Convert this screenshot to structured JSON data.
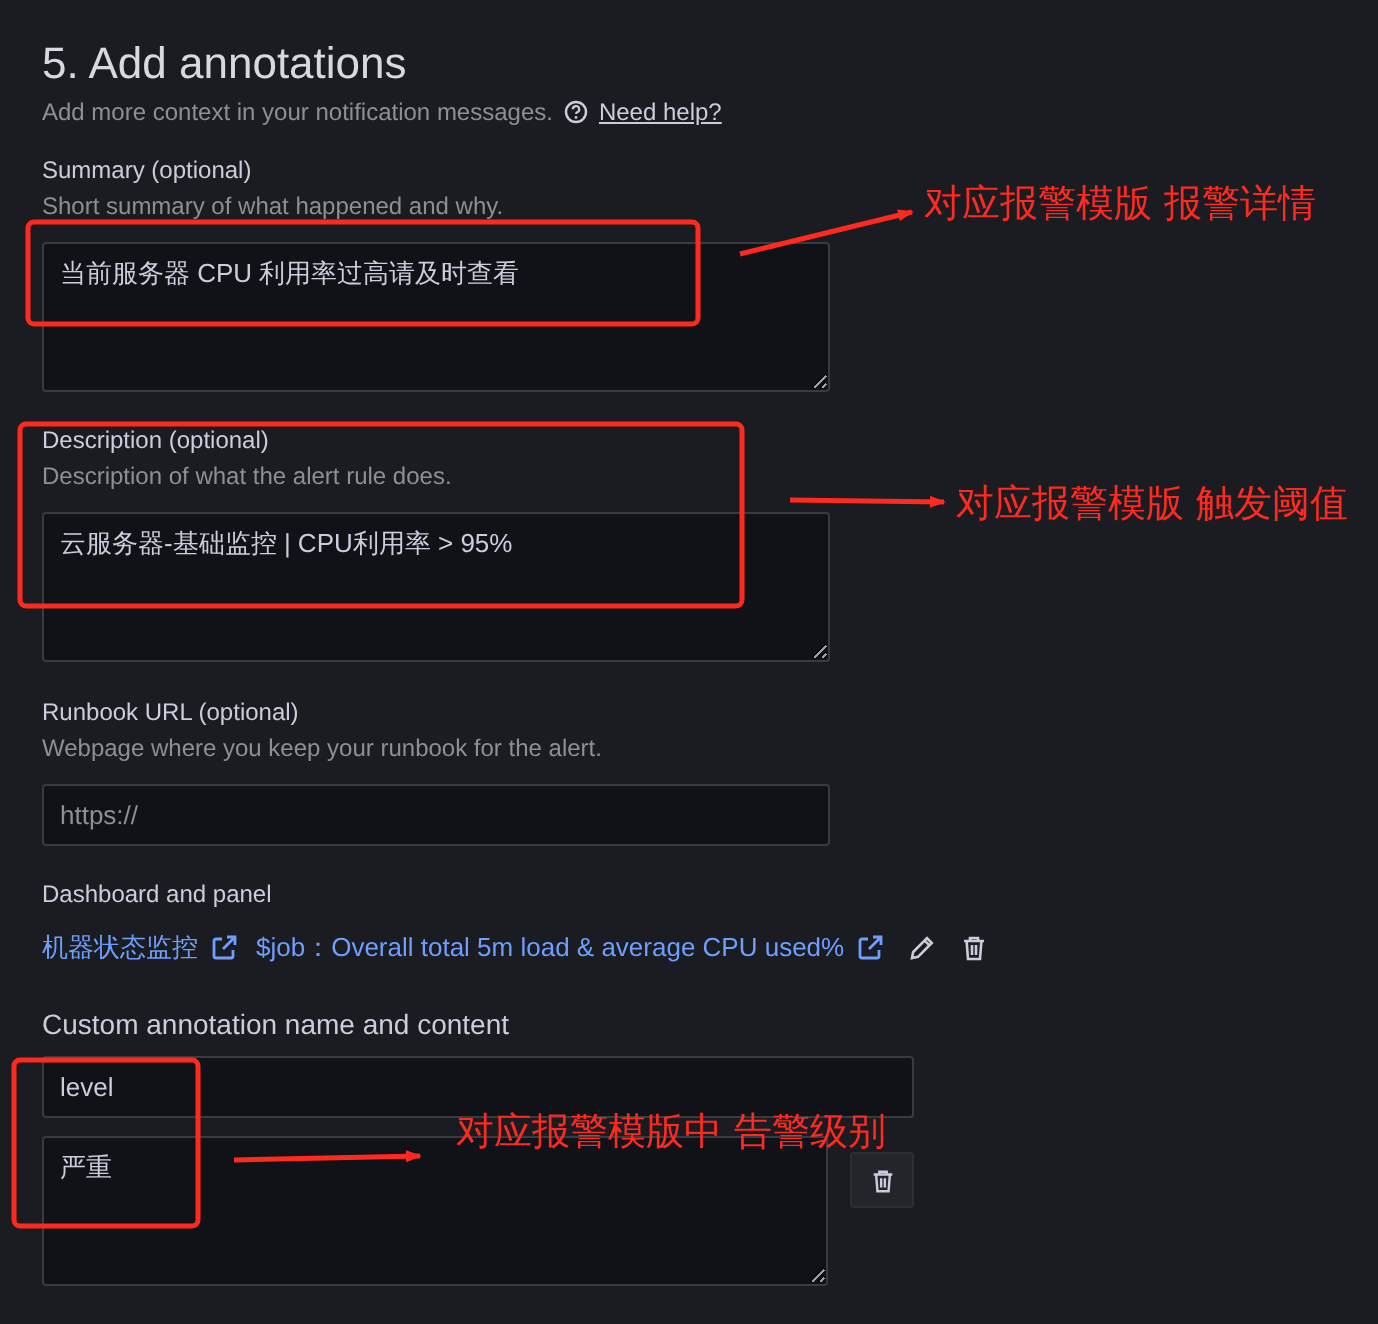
{
  "section": {
    "title": "5. Add annotations",
    "subtitle": "Add more context in your notification messages.",
    "help_link": "Need help?"
  },
  "fields": [
    {
      "kind": "textarea",
      "label": "Summary (optional)",
      "hint": "Short summary of what happened and why.",
      "value": "当前服务器 CPU 利用率过高请及时查看"
    },
    {
      "kind": "textarea",
      "label": "Description (optional)",
      "hint": "Description of what the alert rule does.",
      "value": "云服务器-基础监控 | CPU利用率 > 95%"
    },
    {
      "kind": "input",
      "label": "Runbook URL (optional)",
      "hint": "Webpage where you keep your runbook for the alert.",
      "placeholder": "https://"
    }
  ],
  "dashboard": {
    "label": "Dashboard and panel",
    "dashboard_link": "机器状态监控",
    "panel_link": "$job：Overall total 5m load & average CPU used%"
  },
  "custom": {
    "label": "Custom annotation name and content",
    "name": "level",
    "content": "严重"
  },
  "callouts": [
    {
      "text": "对应报警模版 报警详情"
    },
    {
      "text": "对应报警模版 触发阈值"
    },
    {
      "text": "对应报警模版中 告警级别"
    }
  ]
}
